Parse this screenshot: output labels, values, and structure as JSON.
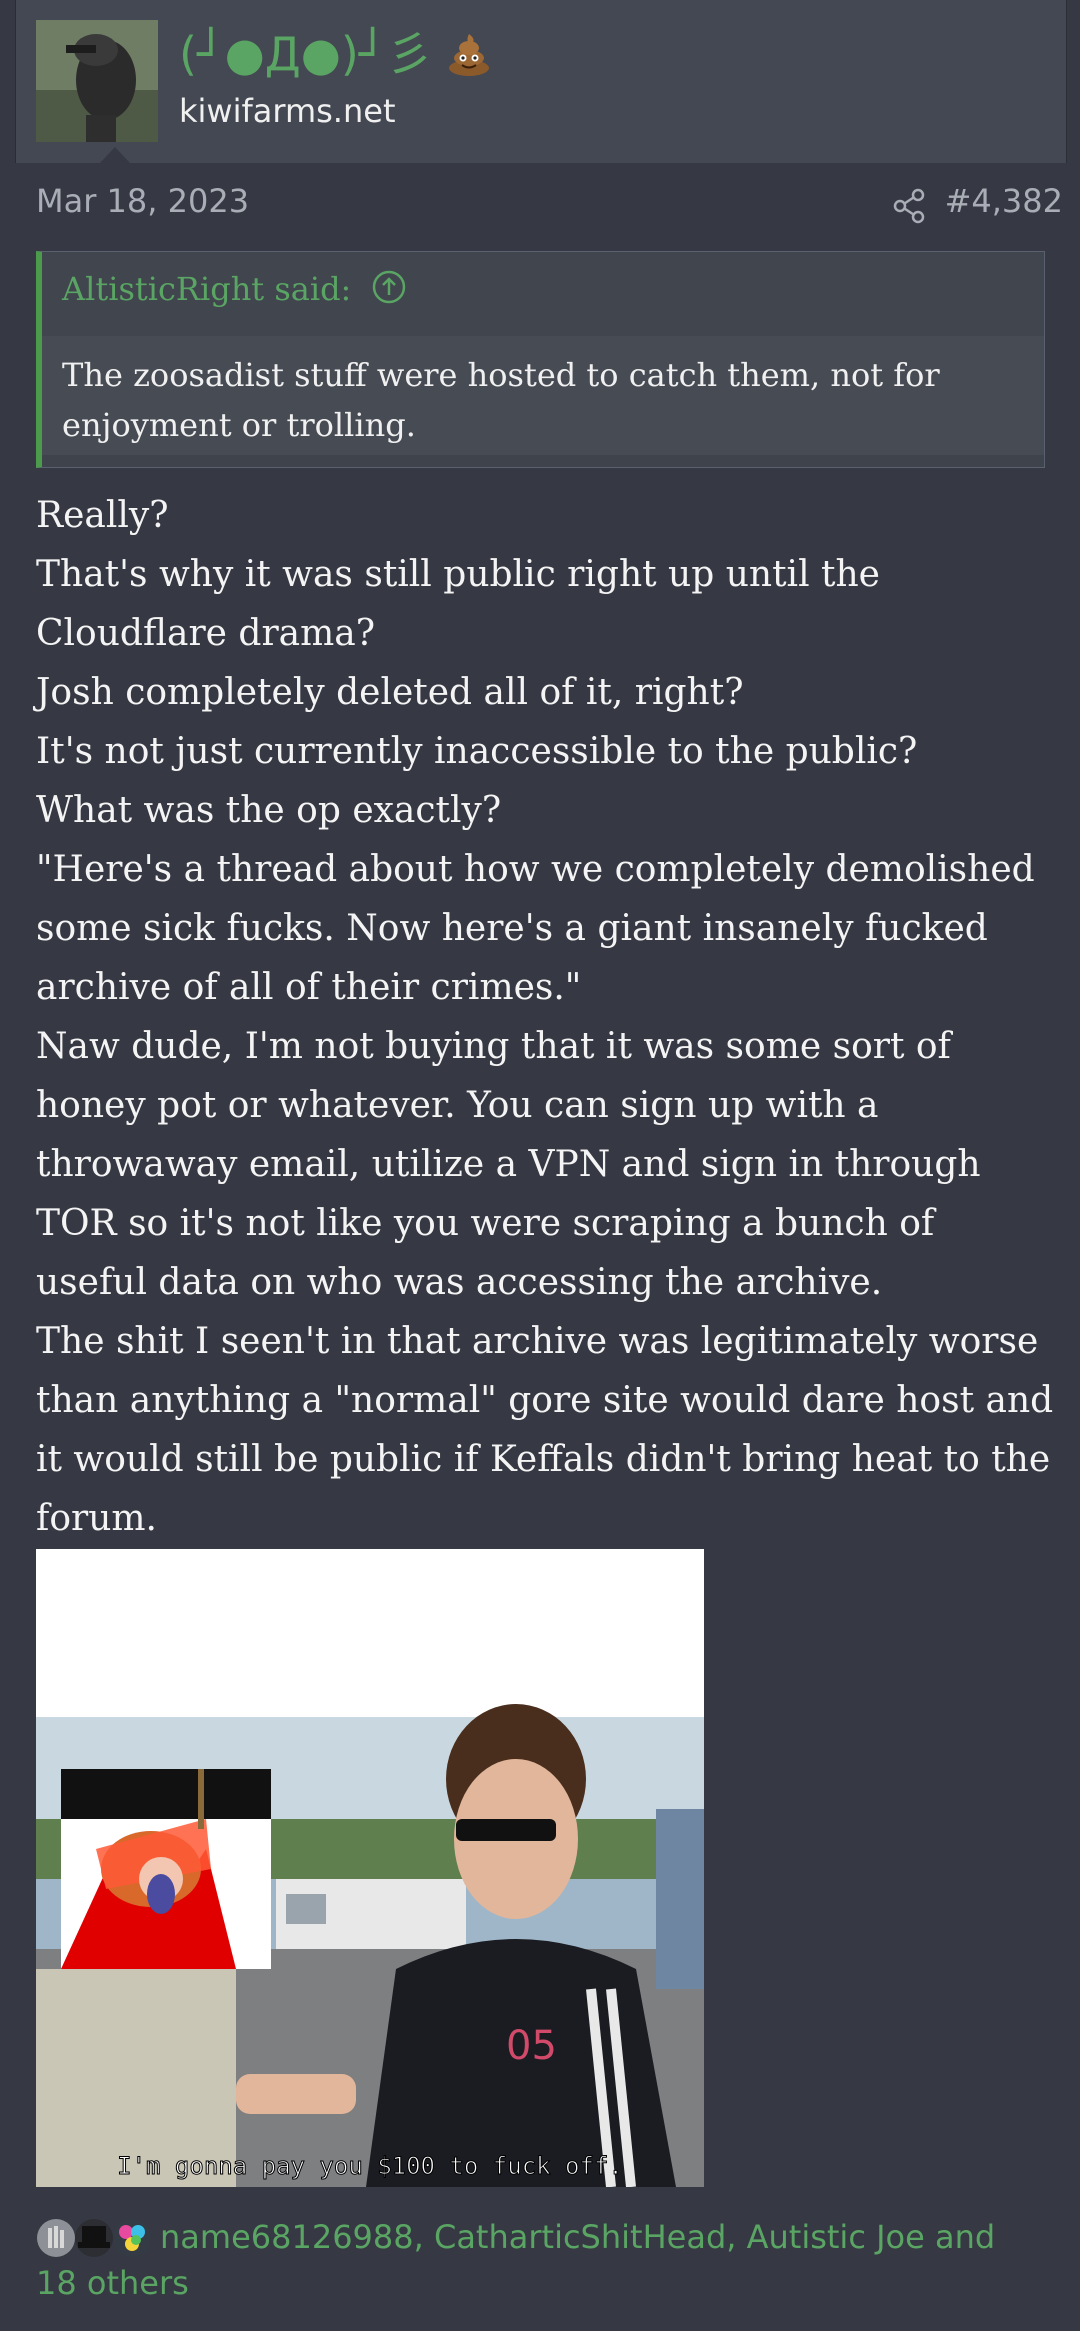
{
  "user": {
    "name": "(┘●Д●)┘彡",
    "domain": "kiwifarms.net"
  },
  "post": {
    "date": "Mar 18, 2023",
    "number": "#4,382"
  },
  "quote": {
    "author": "AltisticRight said:",
    "text": "The zoosadist stuff were hosted to catch them, not for enjoyment or trolling."
  },
  "body": [
    "Really?",
    "That's why it was still public right up until the Cloudflare drama?",
    "Josh completely deleted all of it, right?",
    "It's not just currently inaccessible to the public?",
    "What was the op exactly?",
    "\"Here's a thread about how we completely demolished some sick fucks. Now here's a giant insanely fucked archive of all of their crimes.\"",
    "Naw dude, I'm not buying that it was some sort of honey pot or whatever. You can sign up with a throwaway email, utilize a VPN and sign in through TOR so it's not like you were scraping a bunch of useful data on who was accessing the archive.",
    "The shit I seen't in that archive was legitimately worse than anything a \"normal\" gore site would dare host and it would still be public if Keffals didn't bring heat to the forum."
  ],
  "image": {
    "caption": "I'm gonna pay you $100 to fuck off."
  },
  "reactions": {
    "text": "name68126988, CatharticShitHead, Autistic Joe and 18 others"
  },
  "colors": {
    "background": "#363943",
    "accent": "#5aa563",
    "header": "#434852"
  },
  "icons": [
    "poop-emoji",
    "share-icon",
    "arrow-up-circle-icon",
    "reaction-icons"
  ]
}
